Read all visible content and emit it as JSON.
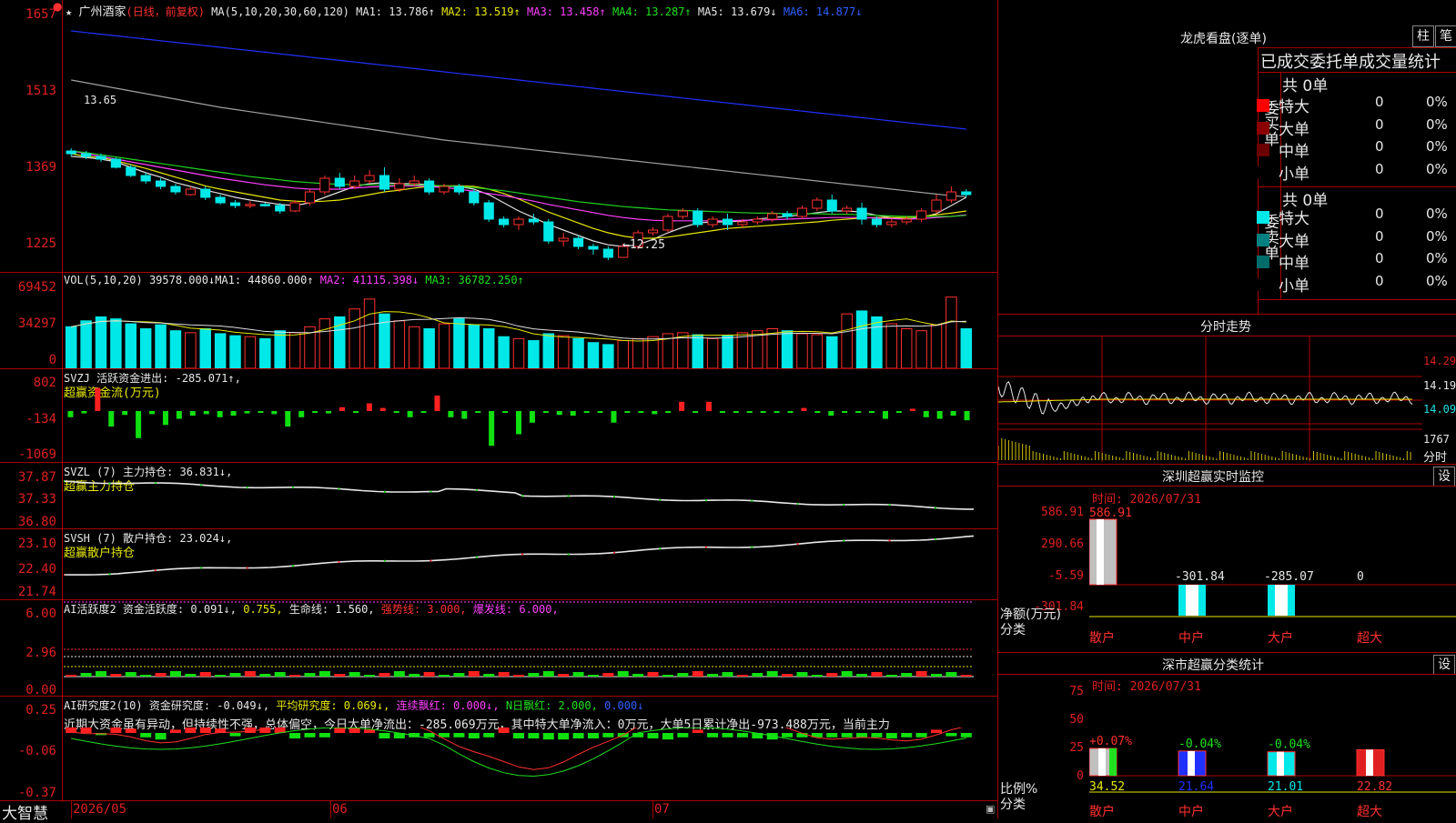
{
  "app": {
    "brand": "大智慧",
    "stock_name": "广州酒家",
    "period_label": "(日线，前复权)"
  },
  "main_chart": {
    "ma_legend": {
      "params": "MA(5,10,20,30,60,120)",
      "ma1": "MA1: 13.786↑",
      "ma2": "MA2: 13.519↑",
      "ma3": "MA3: 13.458↑",
      "ma4": "MA4: 13.287↑",
      "ma5": "MA5: 13.679↓",
      "ma6": "MA6: 14.877↓"
    },
    "yticks": [
      "1657",
      "1513",
      "1369",
      "1225"
    ],
    "high_label": "13.65",
    "low_label": "←12.25",
    "candles": [
      [
        14.2,
        14.15,
        14.25,
        14.1
      ],
      [
        14.15,
        14.1,
        14.2,
        14.05
      ],
      [
        14.1,
        14.05,
        14.15,
        14.0
      ],
      [
        14.05,
        13.9,
        14.08,
        13.88
      ],
      [
        13.9,
        13.75,
        13.95,
        13.72
      ],
      [
        13.75,
        13.65,
        13.8,
        13.6
      ],
      [
        13.65,
        13.55,
        13.7,
        13.5
      ],
      [
        13.55,
        13.45,
        13.6,
        13.4
      ],
      [
        13.4,
        13.5,
        13.55,
        13.38
      ],
      [
        13.5,
        13.35,
        13.55,
        13.3
      ],
      [
        13.35,
        13.25,
        13.4,
        13.22
      ],
      [
        13.25,
        13.2,
        13.3,
        13.15
      ],
      [
        13.2,
        13.22,
        13.28,
        13.15
      ],
      [
        13.22,
        13.2,
        13.25,
        13.18
      ],
      [
        13.2,
        13.1,
        13.25,
        13.05
      ],
      [
        13.1,
        13.25,
        13.3,
        13.08
      ],
      [
        13.25,
        13.45,
        13.5,
        13.2
      ],
      [
        13.45,
        13.7,
        13.75,
        13.4
      ],
      [
        13.7,
        13.55,
        13.8,
        13.5
      ],
      [
        13.55,
        13.65,
        13.75,
        13.5
      ],
      [
        13.65,
        13.75,
        13.85,
        13.6
      ],
      [
        13.75,
        13.5,
        13.9,
        13.45
      ],
      [
        13.5,
        13.6,
        13.7,
        13.45
      ],
      [
        13.6,
        13.65,
        13.75,
        13.55
      ],
      [
        13.65,
        13.45,
        13.7,
        13.4
      ],
      [
        13.45,
        13.55,
        13.6,
        13.4
      ],
      [
        13.55,
        13.45,
        13.6,
        13.4
      ],
      [
        13.45,
        13.25,
        13.5,
        13.2
      ],
      [
        13.25,
        12.95,
        13.3,
        12.9
      ],
      [
        12.95,
        12.85,
        13.0,
        12.8
      ],
      [
        12.85,
        12.95,
        13.0,
        12.75
      ],
      [
        12.95,
        12.9,
        13.05,
        12.85
      ],
      [
        12.9,
        12.55,
        12.95,
        12.5
      ],
      [
        12.55,
        12.6,
        12.7,
        12.45
      ],
      [
        12.6,
        12.45,
        12.65,
        12.4
      ],
      [
        12.45,
        12.4,
        12.5,
        12.3
      ],
      [
        12.4,
        12.25,
        12.45,
        12.2
      ],
      [
        12.25,
        12.45,
        12.5,
        12.25
      ],
      [
        12.45,
        12.7,
        12.75,
        12.4
      ],
      [
        12.7,
        12.75,
        12.8,
        12.65
      ],
      [
        12.75,
        13.0,
        13.05,
        12.7
      ],
      [
        13.0,
        13.1,
        13.15,
        12.95
      ],
      [
        13.1,
        12.85,
        13.15,
        12.8
      ],
      [
        12.85,
        12.95,
        13.0,
        12.8
      ],
      [
        12.95,
        12.85,
        13.05,
        12.75
      ],
      [
        12.85,
        12.9,
        12.95,
        12.8
      ],
      [
        12.9,
        12.95,
        13.0,
        12.85
      ],
      [
        12.95,
        13.05,
        13.1,
        12.9
      ],
      [
        13.05,
        13.0,
        13.1,
        12.95
      ],
      [
        13.0,
        13.15,
        13.2,
        12.95
      ],
      [
        13.15,
        13.3,
        13.35,
        13.1
      ],
      [
        13.3,
        13.1,
        13.4,
        13.05
      ],
      [
        13.1,
        13.15,
        13.2,
        13.05
      ],
      [
        13.15,
        12.95,
        13.25,
        12.85
      ],
      [
        12.95,
        12.85,
        13.0,
        12.8
      ],
      [
        12.85,
        12.9,
        12.95,
        12.8
      ],
      [
        12.9,
        12.95,
        13.0,
        12.85
      ],
      [
        12.95,
        13.1,
        13.15,
        12.9
      ],
      [
        13.1,
        13.3,
        13.4,
        13.05
      ],
      [
        13.3,
        13.45,
        13.55,
        13.25
      ],
      [
        13.45,
        13.4,
        13.5,
        13.35
      ]
    ],
    "ma_lines": {
      "white": [
        14.1,
        14.08,
        14.05,
        14.0,
        13.9,
        13.8,
        13.72,
        13.62,
        13.55,
        13.48,
        13.42,
        13.35,
        13.3,
        13.26,
        13.22,
        13.2,
        13.25,
        13.35,
        13.45,
        13.55,
        13.6,
        13.62,
        13.6,
        13.6,
        13.58,
        13.55,
        13.55,
        13.5,
        13.4,
        13.25,
        13.1,
        12.98,
        12.85,
        12.75,
        12.65,
        12.55,
        12.48,
        12.45,
        12.48,
        12.58,
        12.7,
        12.8,
        12.88,
        12.9,
        12.9,
        12.92,
        12.95,
        12.98,
        13.0,
        13.03,
        13.07,
        13.1,
        13.1,
        13.08,
        13.02,
        12.98,
        12.95,
        12.98,
        13.05,
        13.2,
        13.35
      ],
      "yellow": [
        14.15,
        14.1,
        14.08,
        14.02,
        13.95,
        13.88,
        13.8,
        13.72,
        13.64,
        13.56,
        13.5,
        13.45,
        13.4,
        13.35,
        13.3,
        13.28,
        13.27,
        13.28,
        13.3,
        13.35,
        13.4,
        13.45,
        13.48,
        13.52,
        13.55,
        13.56,
        13.56,
        13.55,
        13.5,
        13.42,
        13.32,
        13.2,
        13.08,
        12.98,
        12.88,
        12.78,
        12.7,
        12.64,
        12.6,
        12.6,
        12.62,
        12.66,
        12.7,
        12.74,
        12.78,
        12.8,
        12.82,
        12.84,
        12.86,
        12.88,
        12.9,
        12.93,
        12.95,
        12.97,
        12.98,
        12.98,
        12.98,
        13.0,
        13.03,
        13.06,
        13.1
      ],
      "magenta": [
        14.2,
        14.15,
        14.1,
        14.05,
        14.0,
        13.95,
        13.9,
        13.85,
        13.8,
        13.75,
        13.7,
        13.66,
        13.62,
        13.58,
        13.55,
        13.52,
        13.5,
        13.5,
        13.5,
        13.52,
        13.54,
        13.55,
        13.56,
        13.56,
        13.55,
        13.53,
        13.5,
        13.46,
        13.42,
        13.38,
        13.33,
        13.28,
        13.22,
        13.17,
        13.12,
        13.07,
        13.02,
        12.98,
        12.95,
        12.93,
        12.92,
        12.92,
        12.92,
        12.92,
        12.92,
        12.93,
        12.93,
        12.94,
        12.95,
        12.96,
        12.97,
        12.98,
        12.98,
        12.98,
        12.97,
        12.96,
        12.95,
        12.96,
        12.98,
        13.0,
        13.03
      ],
      "green": [
        14.2,
        14.17,
        14.13,
        14.09,
        14.05,
        14.01,
        13.97,
        13.93,
        13.89,
        13.85,
        13.81,
        13.77,
        13.73,
        13.7,
        13.67,
        13.64,
        13.62,
        13.6,
        13.59,
        13.58,
        13.58,
        13.58,
        13.58,
        13.58,
        13.57,
        13.56,
        13.55,
        13.53,
        13.5,
        13.47,
        13.43,
        13.39,
        13.35,
        13.31,
        13.27,
        13.24,
        13.21,
        13.18,
        13.16,
        13.14,
        13.12,
        13.11,
        13.1,
        13.09,
        13.08,
        13.07,
        13.06,
        13.06,
        13.05,
        13.05,
        13.05,
        13.04,
        13.04,
        13.03,
        13.02,
        13.01,
        13.0,
        13.0,
        13.0,
        13.0,
        13.02
      ],
      "gray": [
        15.5,
        15.45,
        15.4,
        15.35,
        15.3,
        15.25,
        15.2,
        15.15,
        15.1,
        15.05,
        15.0,
        14.96,
        14.92,
        14.88,
        14.84,
        14.8,
        14.76,
        14.72,
        14.68,
        14.64,
        14.6,
        14.56,
        14.52,
        14.48,
        14.44,
        14.4,
        14.37,
        14.34,
        14.31,
        14.28,
        14.25,
        14.22,
        14.19,
        14.16,
        14.13,
        14.1,
        14.07,
        14.04,
        14.01,
        13.98,
        13.95,
        13.92,
        13.89,
        13.86,
        13.83,
        13.8,
        13.77,
        13.74,
        13.71,
        13.68,
        13.65,
        13.62,
        13.59,
        13.56,
        13.53,
        13.5,
        13.47,
        13.44,
        13.41,
        13.38,
        13.36
      ],
      "blue": [
        16.4,
        16.37,
        16.34,
        16.31,
        16.28,
        16.25,
        16.22,
        16.19,
        16.16,
        16.13,
        16.1,
        16.07,
        16.04,
        16.01,
        15.98,
        15.95,
        15.92,
        15.89,
        15.86,
        15.83,
        15.8,
        15.77,
        15.74,
        15.71,
        15.68,
        15.65,
        15.62,
        15.59,
        15.56,
        15.53,
        15.5,
        15.47,
        15.44,
        15.41,
        15.38,
        15.35,
        15.32,
        15.29,
        15.26,
        15.23,
        15.2,
        15.17,
        15.14,
        15.11,
        15.08,
        15.05,
        15.02,
        14.99,
        14.96,
        14.93,
        14.9,
        14.87,
        14.84,
        14.81,
        14.78,
        14.75,
        14.72,
        14.69,
        14.66,
        14.63,
        14.6
      ]
    }
  },
  "vol_panel": {
    "legend": {
      "params": "VOL(5,10,20)",
      "v": "39578.000↓",
      "ma1": "MA1: 44860.000↑",
      "ma2": "MA2: 41115.398↓",
      "ma3": "MA3: 36782.250↑"
    },
    "yticks": [
      "69452",
      "34297",
      "0"
    ],
    "values": [
      42,
      48,
      52,
      50,
      45,
      40,
      44,
      38,
      36,
      40,
      35,
      33,
      32,
      30,
      38,
      36,
      42,
      50,
      52,
      60,
      70,
      55,
      48,
      42,
      40,
      45,
      50,
      44,
      40,
      32,
      30,
      28,
      35,
      33,
      30,
      26,
      24,
      28,
      30,
      32,
      35,
      36,
      34,
      30,
      33,
      36,
      38,
      40,
      38,
      35,
      34,
      32,
      55,
      58,
      52,
      45,
      40,
      38,
      44,
      72,
      40
    ]
  },
  "svzj_panel": {
    "legend": {
      "name": "SVZJ",
      "label": "活跃资金进出:",
      "value": "-285.071↑,"
    },
    "sublabel": "超赢资金流(万元)",
    "yticks": [
      "802",
      "-134",
      "-1069"
    ],
    "values": [
      -80,
      -30,
      300,
      -200,
      -50,
      -350,
      -40,
      -180,
      -100,
      -60,
      -40,
      -80,
      -60,
      -30,
      -20,
      -40,
      -200,
      -80,
      -20,
      -30,
      50,
      -20,
      100,
      40,
      -20,
      -80,
      -20,
      200,
      -80,
      -100,
      -20,
      -450,
      -20,
      -300,
      -150,
      -20,
      -50,
      -60,
      -10,
      -20,
      -150,
      -20,
      -20,
      -40,
      -20,
      120,
      -20,
      120,
      -20,
      -20,
      -20,
      -20,
      -20,
      -20,
      40,
      -20,
      -60,
      -20,
      -20,
      -20,
      -100,
      -20,
      30,
      -80,
      -100,
      -60,
      -120
    ]
  },
  "svzl_panel": {
    "legend": {
      "name": "SVZL (7)",
      "label": "主力持仓:",
      "value": "36.831↓,"
    },
    "sublabel": "超赢主力持仓",
    "yticks": [
      "37.87",
      "37.33",
      "36.80"
    ]
  },
  "svsh_panel": {
    "legend": {
      "name": "SVSH (7)",
      "label": "散户持仓:",
      "value": "23.024↓,"
    },
    "sublabel": "超赢散户持仓",
    "yticks": [
      "23.10",
      "22.40",
      "21.74"
    ]
  },
  "ai_active_panel": {
    "legend": {
      "name": "AI活跃度2",
      "label": "资金活跃度:",
      "v1": "0.091↓",
      "v2": "0.755",
      "life": "生命线: 1.560,",
      "strong": "强势线: 3.000,",
      "burst": "爆发线: 6.000,"
    },
    "yticks": [
      "6.00",
      "2.96",
      "0.00"
    ]
  },
  "ai_research_panel": {
    "legend": {
      "name": "AI研究度2(10)",
      "label": "资金研究度:",
      "v1": "-0.049↓,",
      "avg": "平均研究度: 0.069↓,",
      "cont": "连续飘红: 0.000↓,",
      "n": "N日飘红: 2.000,",
      "v2": "0.000↓"
    },
    "comment": "近期大资金虽有异动，但持续性不强，总体偏空，今日大单净流出：-285.069万元，其中特大单净流入：0万元，大单5日累计净出-973.488万元，当前主力",
    "yticks": [
      "0.25",
      "-0.06",
      "-0.37"
    ]
  },
  "x_axis": {
    "labels": [
      "2026/05",
      "06",
      "07"
    ]
  },
  "lhb": {
    "title": "龙虎看盘(逐单)",
    "btn_bar": "柱",
    "btn_pen": "笔",
    "header": "已成交委托单成交量统计",
    "buy": {
      "side": "委买单",
      "total": "共 0单",
      "rows": [
        {
          "name": "特大",
          "n": "0",
          "p": "0%",
          "color": "#ff0000"
        },
        {
          "name": "大单",
          "n": "0",
          "p": "0%",
          "color": "#8b0000"
        },
        {
          "name": "中单",
          "n": "0",
          "p": "0%",
          "color": "#6b0000"
        },
        {
          "name": "小单",
          "n": "0",
          "p": "0%",
          "color": "#000000"
        }
      ]
    },
    "sell": {
      "side": "委卖单",
      "total": "共 0单",
      "rows": [
        {
          "name": "特大",
          "n": "0",
          "p": "0%",
          "color": "#00e8e8"
        },
        {
          "name": "大单",
          "n": "0",
          "p": "0%",
          "color": "#008080"
        },
        {
          "name": "中单",
          "n": "0",
          "p": "0%",
          "color": "#006b6b"
        },
        {
          "name": "小单",
          "n": "0",
          "p": "0%",
          "color": "#000000"
        }
      ]
    }
  },
  "intraday": {
    "title": "分时走势",
    "yticks": [
      "14.29",
      "14.19",
      "14.09",
      "1767"
    ],
    "right_label": "分时"
  },
  "monitor": {
    "title": "深圳超赢实时监控",
    "settings": "设",
    "time": "时间: 2026/07/31",
    "yticks": [
      "586.91",
      "290.66",
      "-5.59",
      "-301.84"
    ],
    "ylabel": "净额(万元)",
    "xlabel": "分类",
    "bars": [
      {
        "cat": "散户",
        "value": "586.91",
        "v": 586.91
      },
      {
        "cat": "中户",
        "value": "-301.84",
        "v": -301.84
      },
      {
        "cat": "大户",
        "value": "-285.07",
        "v": -285.07
      },
      {
        "cat": "超大",
        "value": "0",
        "v": 0
      }
    ]
  },
  "classify": {
    "title": "深市超赢分类统计",
    "settings": "设",
    "time": "时间: 2026/07/31",
    "yticks": [
      "75",
      "50",
      "25",
      "0"
    ],
    "ylabel": "比例%",
    "xlabel": "分类",
    "bars": [
      {
        "cat": "散户",
        "delta": "+0.07%",
        "value": "34.52",
        "v": 34.52,
        "color": "#c0c0c0"
      },
      {
        "cat": "中户",
        "delta": "-0.04%",
        "value": "21.64",
        "v": 21.64,
        "color": "#2030ff"
      },
      {
        "cat": "大户",
        "delta": "-0.04%",
        "value": "21.01",
        "v": 21.01,
        "color": "#00e8e8"
      },
      {
        "cat": "超大",
        "delta": "",
        "value": "22.82",
        "v": 22.82,
        "color": "#e02020"
      }
    ]
  },
  "colors": {
    "up": "#ff3030",
    "down": "#00e8e8",
    "grid": "#aa0000",
    "text_axis": "#e02020"
  }
}
